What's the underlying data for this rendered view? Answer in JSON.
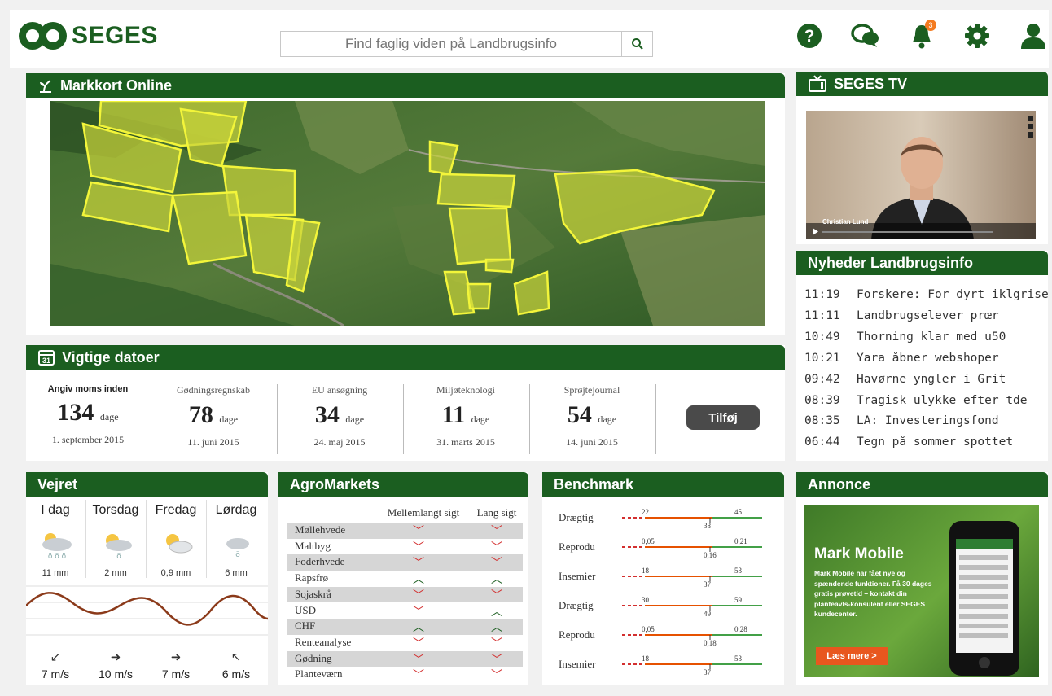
{
  "header": {
    "brand": "SEGES",
    "search_placeholder": "Find faglig viden på Landbrugsinfo",
    "notification_count": "3"
  },
  "colors": {
    "brand_green": "#1b5e20",
    "down_red": "#d32f2f",
    "orange": "#f47b20"
  },
  "markkort": {
    "title": "Markkort Online"
  },
  "tv": {
    "title": "SEGES TV",
    "presenter": "Christian Lund"
  },
  "dates": {
    "title": "Vigtige datoer",
    "items": [
      {
        "label": "Angiv moms inden",
        "number": "134",
        "unit": "dage",
        "date": "1. september 2015"
      },
      {
        "label": "Gødningsregnskab",
        "number": "78",
        "unit": "dage",
        "date": "11. juni 2015"
      },
      {
        "label": "EU ansøgning",
        "number": "34",
        "unit": "dage",
        "date": "24. maj 2015"
      },
      {
        "label": "Miljøteknologi",
        "number": "11",
        "unit": "dage",
        "date": "31. marts 2015"
      },
      {
        "label": "Sprøjtejournal",
        "number": "54",
        "unit": "dage",
        "date": "14. juni 2015"
      }
    ],
    "add_button": "Tilføj"
  },
  "weather": {
    "title": "Vejret",
    "days": [
      {
        "name": "I dag",
        "rain": "11 mm",
        "wind": "7 m/s",
        "icon": "cloud-rain-icon",
        "wind_dir": "arrow-down-left-icon"
      },
      {
        "name": "Torsdag",
        "rain": "2 mm",
        "wind": "10 m/s",
        "icon": "sun-cloud-rain-icon",
        "wind_dir": "arrow-right-icon"
      },
      {
        "name": "Fredag",
        "rain": "0,9 mm",
        "wind": "7 m/s",
        "icon": "sun-cloud-icon",
        "wind_dir": "arrow-right-icon"
      },
      {
        "name": "Lørdag",
        "rain": "6 mm",
        "wind": "6 m/s",
        "icon": "cloud-rain-icon",
        "wind_dir": "arrow-up-left-icon"
      }
    ]
  },
  "agromarkets": {
    "title": "AgroMarkets",
    "col1": "Mellemlangt sigt",
    "col2": "Lang sigt",
    "rows": [
      {
        "name": "Møllehvede",
        "mid": "down",
        "long": "down"
      },
      {
        "name": "Maltbyg",
        "mid": "down",
        "long": "down"
      },
      {
        "name": "Foderhvede",
        "mid": "down",
        "long": "down"
      },
      {
        "name": "Rapsfrø",
        "mid": "up",
        "long": "up"
      },
      {
        "name": "Sojaskrå",
        "mid": "down",
        "long": "down"
      },
      {
        "name": "USD",
        "mid": "down",
        "long": "up"
      },
      {
        "name": "CHF",
        "mid": "up",
        "long": "up"
      },
      {
        "name": "Renteanalyse",
        "mid": "down",
        "long": "down"
      },
      {
        "name": "Gødning",
        "mid": "down",
        "long": "down"
      },
      {
        "name": "Planteværn",
        "mid": "down",
        "long": "down"
      }
    ]
  },
  "benchmark": {
    "title": "Benchmark",
    "rows": [
      {
        "label": "Drægtig",
        "low": "22",
        "high": "45",
        "value": "38"
      },
      {
        "label": "Reprodu",
        "low": "0,05",
        "high": "0,21",
        "value": "0,16"
      },
      {
        "label": "Insemier",
        "low": "18",
        "high": "53",
        "value": "37"
      },
      {
        "label": "Drægtig",
        "low": "30",
        "high": "59",
        "value": "49"
      },
      {
        "label": "Reprodu",
        "low": "0,05",
        "high": "0,28",
        "value": "0,18"
      },
      {
        "label": "Insemier",
        "low": "18",
        "high": "53",
        "value": "37"
      }
    ]
  },
  "news": {
    "title": "Nyheder Landbrugsinfo",
    "items": [
      {
        "time": "11:19",
        "text": "Forskere: For dyrt iklgrise"
      },
      {
        "time": "11:11",
        "text": "Landbrugselever prœr"
      },
      {
        "time": "10:49",
        "text": "Thorning klar med u50"
      },
      {
        "time": "10:21",
        "text": "Yara åbner webshoper"
      },
      {
        "time": "09:42",
        "text": "Havørne yngler i Grit"
      },
      {
        "time": "08:39",
        "text": "Tragisk ulykke efter tde"
      },
      {
        "time": "08:35",
        "text": "LA: Investeringsfond"
      },
      {
        "time": "06:44",
        "text": "Tegn på sommer spottet"
      }
    ]
  },
  "ad": {
    "title": "Annonce",
    "headline": "Mark Mobile",
    "body": "Mark Mobile har fået nye og spændende funktioner. Få 30 dages gratis prøvetid – kontakt din planteavls-konsulent eller SEGES kundecenter.",
    "cta": "Læs mere >"
  }
}
